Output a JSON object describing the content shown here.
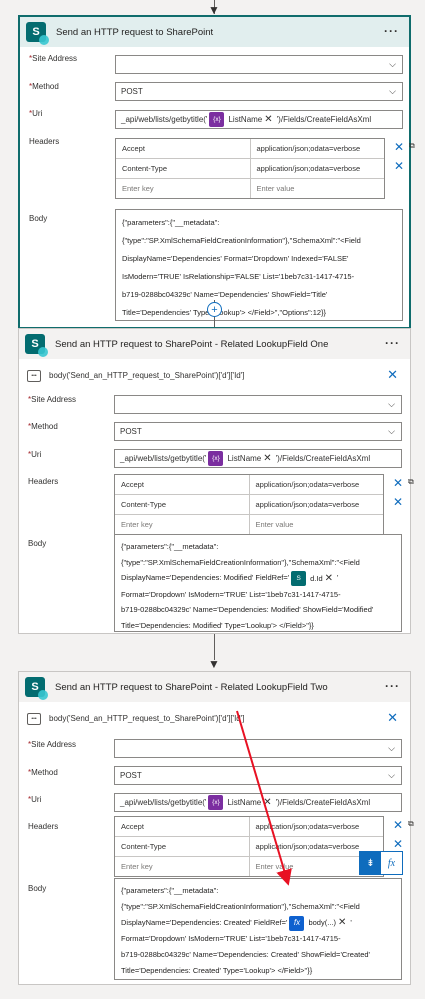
{
  "labels": {
    "site_address": "Site Address",
    "method": "Method",
    "uri": "Uri",
    "headers": "Headers",
    "body": "Body",
    "required_mark": "*"
  },
  "cards": [
    {
      "title": "Send an HTTP request to SharePoint",
      "menu": "···",
      "site_address_value": "",
      "method_value": "POST",
      "uri": {
        "prefix": "_api/web/lists/getbytitle('",
        "token_label": "ListName",
        "token_icon": "{x}",
        "suffix": "')/Fields/CreateFieldAsXml"
      },
      "headers": [
        {
          "key": "Accept",
          "value": "application/json;odata=verbose"
        },
        {
          "key": "Content-Type",
          "value": "application/json;odata=verbose"
        },
        {
          "key": "Enter key",
          "value": "Enter value"
        }
      ],
      "body_lines": [
        "{\"parameters\":{\"__metadata\":",
        "{\"type\":\"SP.XmlSchemaFieldCreationInformation\"},\"SchemaXml\":\"<Field",
        "DisplayName='Dependencies' Format='Dropdown' Indexed='FALSE'",
        "IsModern='TRUE' IsRelationship='FALSE' List='1beb7c31-1417-4715-",
        "b719-0288bc04329c' Name='Dependencies' ShowField='Title'",
        "Title='Dependencies' Type='Lookup'> </Field>\",\"Options\":12}}"
      ]
    },
    {
      "title": "Send an HTTP request to SharePoint - Related LookupField One",
      "menu": "···",
      "dynamic_expr": "body('Send_an_HTTP_request_to_SharePoint')['d']['Id']",
      "site_address_value": "",
      "method_value": "POST",
      "uri": {
        "prefix": "_api/web/lists/getbytitle('",
        "token_label": "ListName",
        "token_icon": "{x}",
        "suffix": "')/Fields/CreateFieldAsXml"
      },
      "headers": [
        {
          "key": "Accept",
          "value": "application/json;odata=verbose"
        },
        {
          "key": "Content-Type",
          "value": "application/json;odata=verbose"
        },
        {
          "key": "Enter key",
          "value": "Enter value"
        }
      ],
      "body_lines": [
        "{\"parameters\":{\"__metadata\":",
        "{\"type\":\"SP.XmlSchemaFieldCreationInformation\"},\"SchemaXml\":\"<Field",
        "DisplayName='Dependencies: Modified' FieldRef='",
        "Format='Dropdown' IsModern='TRUE' List='1beb7c31-1417-4715-",
        "b719-0288bc04329c' Name='Dependencies: Modified' ShowField='Modified'",
        "Title='Dependencies: Modified' Type='Lookup'> </Field>\"}}"
      ],
      "body_token_label": "d.Id",
      "body_token_icon": "S",
      "body_token_after": "'"
    },
    {
      "title": "Send an HTTP request to SharePoint - Related LookupField Two",
      "menu": "···",
      "dynamic_expr": "body('Send_an_HTTP_request_to_SharePoint')['d']['Id']",
      "site_address_value": "",
      "method_value": "POST",
      "uri": {
        "prefix": "_api/web/lists/getbytitle('",
        "token_label": "ListName",
        "token_icon": "{x}",
        "suffix": "')/Fields/CreateFieldAsXml"
      },
      "headers": [
        {
          "key": "Accept",
          "value": "application/json;odata=verbose"
        },
        {
          "key": "Content-Type",
          "value": "application/json;odata=verbose"
        },
        {
          "key": "Enter key",
          "value": "Enter value"
        }
      ],
      "body_lines": [
        "{\"parameters\":{\"__metadata\":",
        "{\"type\":\"SP.XmlSchemaFieldCreationInformation\"},\"SchemaXml\":\"<Field",
        "DisplayName='Dependencies: Created' FieldRef='",
        "Format='Dropdown' IsModern='TRUE' List='1beb7c31-1417-4715-",
        "b719-0288bc04329c' Name='Dependencies: Created' ShowField='Created'",
        "Title='Dependencies: Created' Type='Lookup'> </Field>\"}}"
      ],
      "body_token_label": "body(...)",
      "body_token_icon": "fx",
      "body_token_after": "'"
    }
  ],
  "toolbar": {
    "dynamic_icon": "dynamic-content-icon",
    "fx_label": "fx"
  },
  "plus_label": "+",
  "colors": {
    "accent": "#0f6cbd",
    "selected_border": "#0f6c6c",
    "sharepoint": "#036c70",
    "variable_token": "#7b2ea0",
    "expression_token": "#0f61cf",
    "annotation_arrow": "#e81123"
  }
}
